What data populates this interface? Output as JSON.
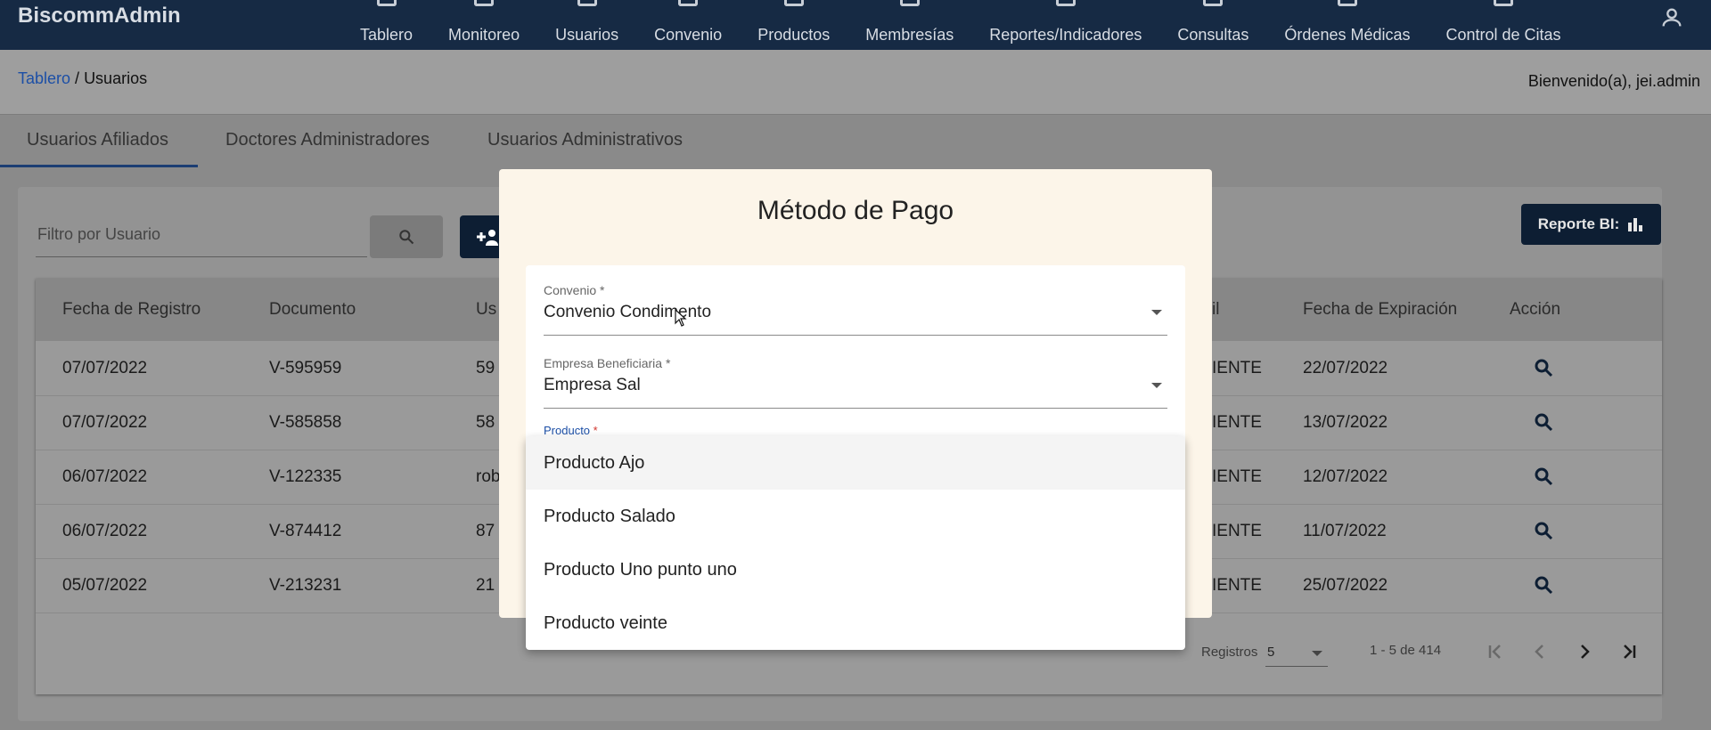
{
  "app": {
    "title": "BiscommAdmin"
  },
  "nav": [
    {
      "label": "Tablero"
    },
    {
      "label": "Monitoreo"
    },
    {
      "label": "Usuarios"
    },
    {
      "label": "Convenio"
    },
    {
      "label": "Productos"
    },
    {
      "label": "Membresías"
    },
    {
      "label": "Reportes/Indicadores"
    },
    {
      "label": "Consultas"
    },
    {
      "label": "Órdenes Médicas"
    },
    {
      "label": "Control de Citas"
    }
  ],
  "breadcrumb": {
    "root": "Tablero",
    "separator": " / ",
    "current": "Usuarios"
  },
  "welcome": "Bienvenido(a), jei.admin",
  "tabs": [
    {
      "label": "Usuarios Afiliados",
      "active": true
    },
    {
      "label": "Doctores Administradores",
      "active": false
    },
    {
      "label": "Usuarios Administrativos",
      "active": false
    }
  ],
  "toolbar": {
    "filter_placeholder": "Filtro por Usuario",
    "add_icon": "add-user-icon",
    "report_label": "Reporte BI:"
  },
  "table": {
    "headers": {
      "fecha_registro": "Fecha de Registro",
      "documento": "Documento",
      "usuario_partial": "Us",
      "perfil_partial": "il",
      "fecha_expiracion": "Fecha de Expiración",
      "accion": "Acción"
    },
    "rows": [
      {
        "fecha": "07/07/2022",
        "documento": "V-595959",
        "usuario": "59",
        "estado": "IENTE",
        "expira": "22/07/2022"
      },
      {
        "fecha": "07/07/2022",
        "documento": "V-585858",
        "usuario": "58",
        "estado": "IENTE",
        "expira": "13/07/2022"
      },
      {
        "fecha": "06/07/2022",
        "documento": "V-122335",
        "usuario": "rob",
        "estado": "IENTE",
        "expira": "12/07/2022"
      },
      {
        "fecha": "06/07/2022",
        "documento": "V-874412",
        "usuario": "87",
        "estado": "IENTE",
        "expira": "11/07/2022"
      },
      {
        "fecha": "05/07/2022",
        "documento": "V-213231",
        "usuario": "21",
        "estado": "IENTE",
        "expira": "25/07/2022"
      }
    ]
  },
  "pagination": {
    "label": "Registros",
    "page_size": "5",
    "range": "1 - 5 de 414"
  },
  "modal": {
    "title": "Método de Pago",
    "fields": {
      "convenio": {
        "label": "Convenio *",
        "value": "Convenio Condimento"
      },
      "empresa": {
        "label": "Empresa Beneficiaria *",
        "value": "Empresa Sal"
      },
      "producto": {
        "label": "Producto",
        "required_mark": "*"
      }
    },
    "product_options": [
      {
        "label": "Producto Ajo",
        "highlighted": true
      },
      {
        "label": "Producto Salado",
        "highlighted": false
      },
      {
        "label": "Producto Uno punto uno",
        "highlighted": false
      },
      {
        "label": "Producto veinte",
        "highlighted": false
      }
    ]
  },
  "colors": {
    "nav_bg": "#162a44",
    "primary": "#0d1e33",
    "link": "#1c4fa6",
    "modal_bg": "#fcf5e9",
    "required": "#d0342c"
  }
}
